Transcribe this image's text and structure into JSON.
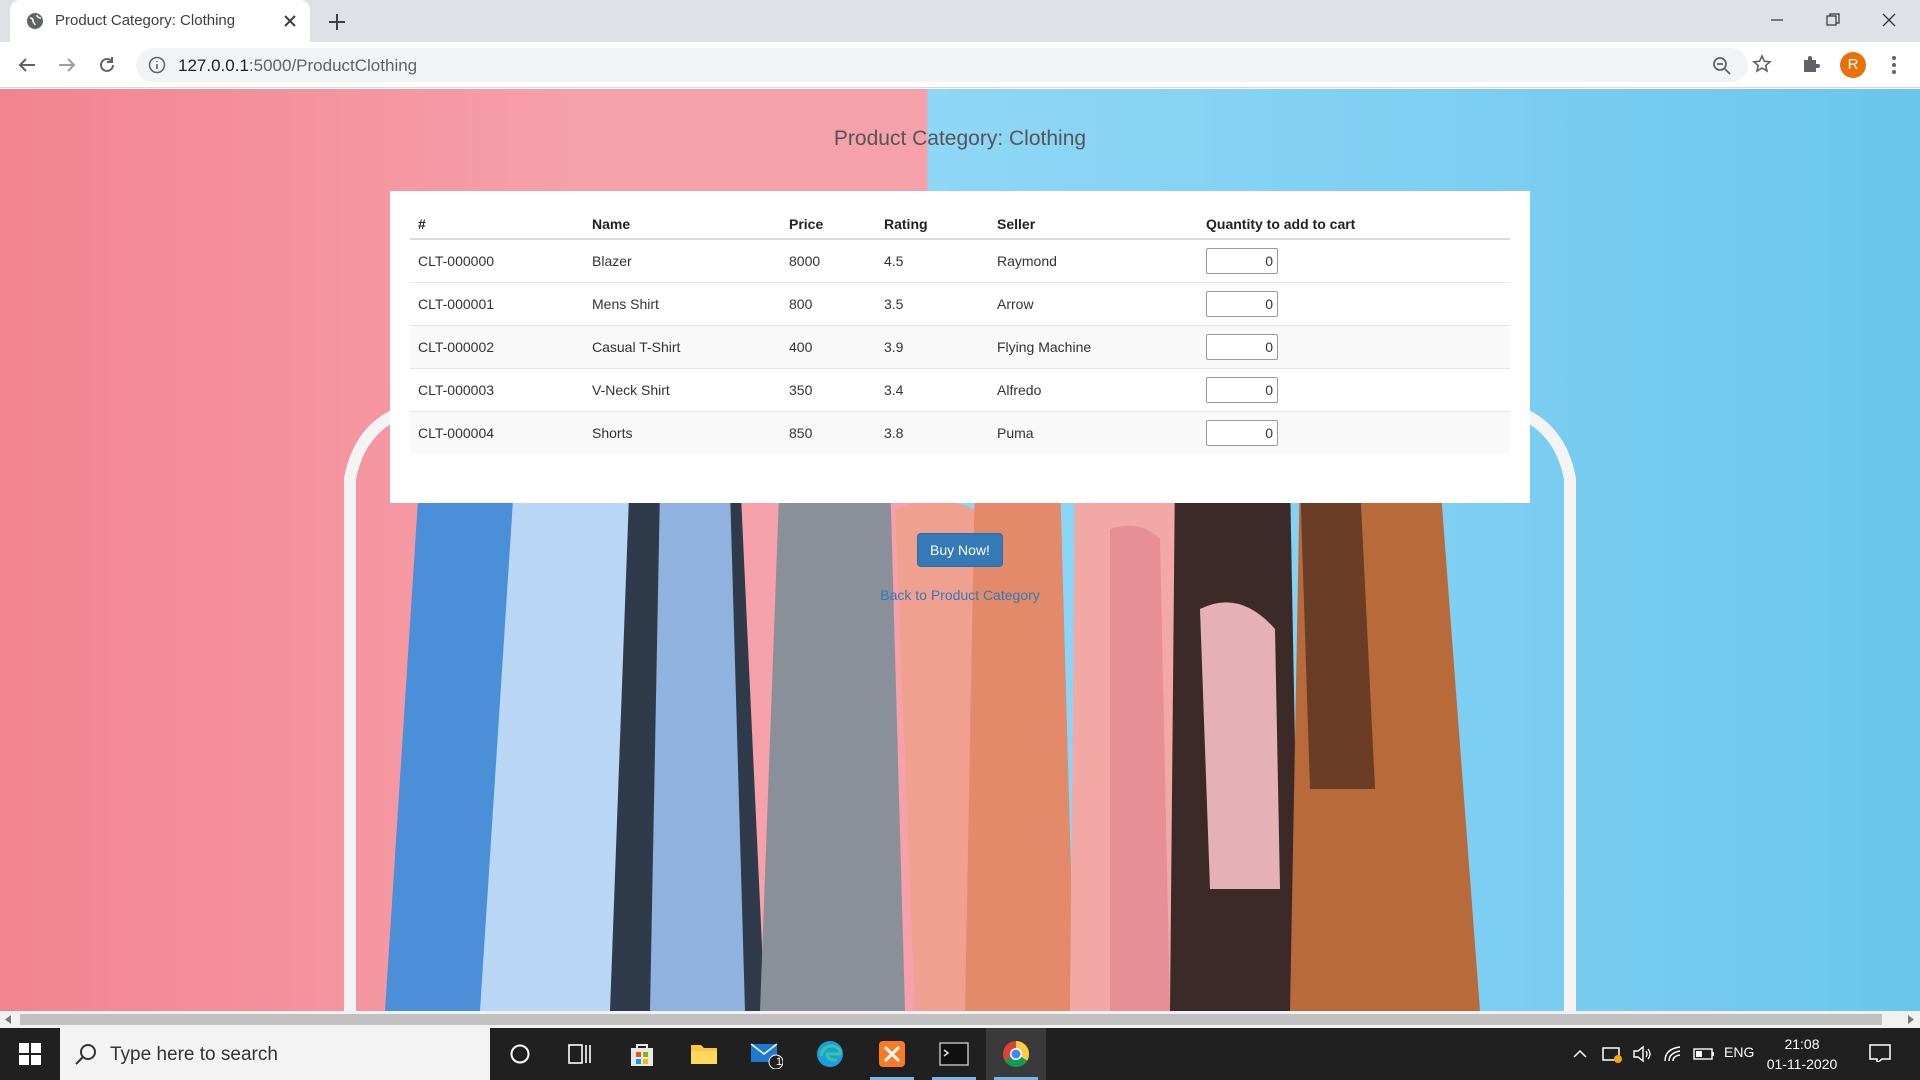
{
  "browser": {
    "tab_title": "Product Category: Clothing",
    "url_host": "127.0.0.1",
    "url_rest": ":5000/ProductClothing",
    "profile_initial": "R"
  },
  "page": {
    "title": "Product Category: Clothing",
    "columns": [
      "#",
      "Name",
      "Price",
      "Rating",
      "Seller",
      "Quantity to add to cart"
    ],
    "rows": [
      {
        "id": "CLT-000000",
        "name": "Blazer",
        "price": "8000",
        "rating": "4.5",
        "seller": "Raymond",
        "qty": "0"
      },
      {
        "id": "CLT-000001",
        "name": "Mens Shirt",
        "price": "800",
        "rating": "3.5",
        "seller": "Arrow",
        "qty": "0"
      },
      {
        "id": "CLT-000002",
        "name": "Casual T-Shirt",
        "price": "400",
        "rating": "3.9",
        "seller": "Flying Machine",
        "qty": "0"
      },
      {
        "id": "CLT-000003",
        "name": "V-Neck Shirt",
        "price": "350",
        "rating": "3.4",
        "seller": "Alfredo",
        "qty": "0"
      },
      {
        "id": "CLT-000004",
        "name": "Shorts",
        "price": "850",
        "rating": "3.8",
        "seller": "Puma",
        "qty": "0"
      }
    ],
    "buy_label": "Buy Now!",
    "back_link": "Back to Product Category"
  },
  "taskbar": {
    "search_placeholder": "Type here to search",
    "mail_badge": "1",
    "language": "ENG",
    "time": "21:08",
    "date": "01-11-2020"
  },
  "colors": {
    "accent": "#337ab7",
    "bg_pink": "#f6a0aa",
    "bg_blue": "#8fd7f6"
  }
}
